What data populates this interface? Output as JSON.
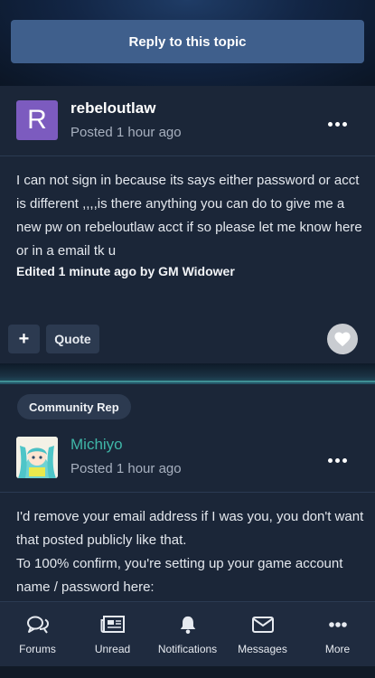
{
  "reply_button": {
    "label": "Reply to this topic"
  },
  "posts": [
    {
      "avatar_letter": "R",
      "username": "rebeloutlaw",
      "posted": "Posted 1 hour ago",
      "content": "I can not sign in because its says either password or acct is different ,,,,is there anything you can do to give me a new pw on rebeloutlaw acct if so please let me know here or in a email tk u",
      "edited": "Edited 1 minute ago by GM Widower",
      "actions": {
        "plus": "+",
        "quote": "Quote"
      },
      "colors": {
        "avatar_bg": "#7c5bbf"
      }
    },
    {
      "badge": "Community Rep",
      "username": "Michiyo",
      "posted": "Posted 1 hour ago",
      "content_lines": [
        "I'd remove your email address if I was you, you don't want that posted publicly like that.",
        "To 100% confirm, you're setting up your game account name / password here:"
      ],
      "colors": {
        "username": "#3fb6a8"
      }
    }
  ],
  "bottom_nav": [
    {
      "label": "Forums",
      "icon": "forums-icon"
    },
    {
      "label": "Unread",
      "icon": "newspaper-icon"
    },
    {
      "label": "Notifications",
      "icon": "bell-icon"
    },
    {
      "label": "Messages",
      "icon": "envelope-icon"
    },
    {
      "label": "More",
      "icon": "more-dots-icon"
    }
  ]
}
